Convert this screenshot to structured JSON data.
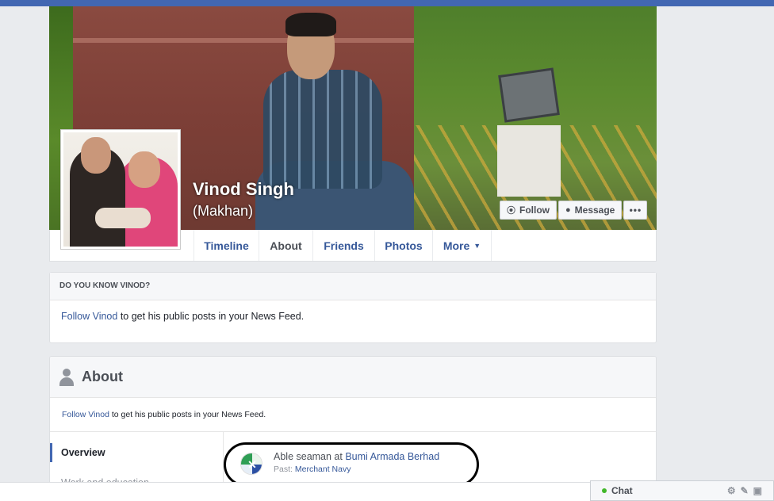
{
  "profile": {
    "name": "Vinod Singh",
    "alt_name": "(Makhan)"
  },
  "actions": {
    "follow": "Follow",
    "message": "Message",
    "more": "•••"
  },
  "tabs": [
    {
      "label": "Timeline"
    },
    {
      "label": "About"
    },
    {
      "label": "Friends"
    },
    {
      "label": "Photos"
    },
    {
      "label": "More"
    }
  ],
  "know_card": {
    "heading": "DO YOU KNOW VINOD?",
    "follow_link": "Follow Vinod",
    "follow_text": " to get his public posts in your News Feed."
  },
  "about_card": {
    "title": "About",
    "follow_link": "Follow Vinod",
    "follow_text": " to get his public posts in your News Feed.",
    "side_items": [
      {
        "label": "Overview"
      },
      {
        "label": "Work and education"
      }
    ],
    "job": {
      "role_text": "Able seaman at ",
      "company": "Bumi Armada Berhad",
      "past_label": "Past: ",
      "past_value": "Merchant Navy"
    }
  },
  "chat": {
    "label": "Chat"
  },
  "colors": {
    "brand": "#4267b2",
    "link": "#365899",
    "online": "#42b72a"
  }
}
